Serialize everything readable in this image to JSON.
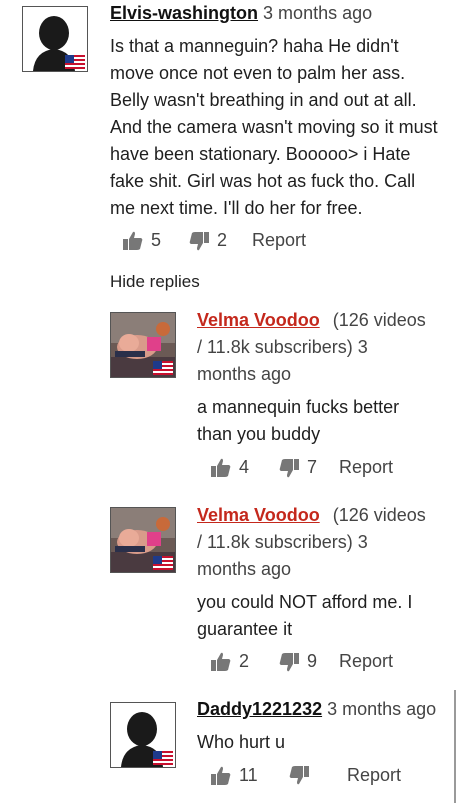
{
  "comments": [
    {
      "username": "Elvis-washington",
      "meta": "3 months ago",
      "text_lines": [
        "Is that a manneguin? haha He didn't",
        "move once not even to palm her ass.",
        "Belly wasn't breathing in and out at all.",
        "And the camera wasn't moving so it must",
        "have been stationary. Booooo> i Hate",
        "fake shit. Girl was hot as fuck tho. Call",
        "me next time. I'll do her for free."
      ],
      "likes": "5",
      "dislikes": "2",
      "report_label": "Report"
    }
  ],
  "hide_replies_label": "Hide replies",
  "replies": [
    {
      "username": "Velma Voodoo",
      "meta_lines": [
        "(126 videos",
        "/ 11.8k subscribers)  3",
        "months ago"
      ],
      "text_lines": [
        "a mannequin fucks better",
        "than you buddy"
      ],
      "likes": "4",
      "dislikes": "7",
      "report_label": "Report"
    },
    {
      "username": "Velma Voodoo",
      "meta_lines": [
        "(126 videos",
        "/ 11.8k subscribers)  3",
        "months ago"
      ],
      "text_lines": [
        "you could NOT afford me. I",
        "guarantee it"
      ],
      "likes": "2",
      "dislikes": "9",
      "report_label": "Report"
    },
    {
      "username": "Daddy1221232",
      "meta": "3 months ago",
      "text_lines": [
        "Who hurt u"
      ],
      "likes": "11",
      "dislikes": "",
      "report_label": "Report"
    }
  ],
  "colors": {
    "username_red": "#c4281c",
    "text": "#1f1f1f",
    "secondary": "#444444"
  },
  "icons": [
    "thumbs-up-icon",
    "thumbs-down-icon",
    "us-flag-icon",
    "avatar-silhouette-icon"
  ]
}
